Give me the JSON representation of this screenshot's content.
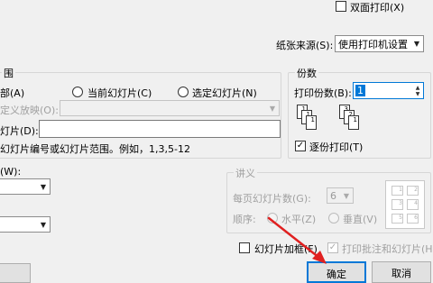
{
  "duplex": {
    "label": "双面打印(X)",
    "checked": false
  },
  "paper_source": {
    "label": "纸张来源(S):",
    "value": "使用打印机设置"
  },
  "print_range": {
    "title": "围",
    "all_label": "部(A)",
    "current_slide_label": "当前幻灯片(C)",
    "selection_label": "选定幻灯片(N)",
    "custom_show_label": "定义放映(O):",
    "slides_label": "灯片(D):",
    "hint": "幻灯片编号或幻灯片范围。例如，1,3,5-12"
  },
  "copies": {
    "title": "份数",
    "count_label": "打印份数(B):",
    "count_value": "1",
    "collate_label": "逐份打印(T)",
    "collate_checked": true,
    "stack1": [
      "1",
      "1",
      "1"
    ],
    "stack2": [
      "3",
      "2",
      "1"
    ]
  },
  "print_what": {
    "label": "(W):",
    "value": ""
  },
  "color": {
    "value": ""
  },
  "handouts": {
    "title": "讲义",
    "per_page_label": "每页幻灯片数(G):",
    "per_page_value": "6",
    "order_label": "顺序:",
    "horizontal_label": "水平(Z)",
    "vertical_label": "垂直(V)",
    "preview_numbers": [
      "1",
      "2",
      "3",
      "4",
      "5",
      "6"
    ]
  },
  "frame_slides": {
    "label": "幻灯片加框(F)",
    "checked": false
  },
  "print_comments": {
    "label": "打印批注和幻灯片(H)",
    "checked": true
  },
  "ok_button": {
    "label": "确定"
  },
  "cancel_button": {
    "label": "取消"
  },
  "colors": {
    "accent": "#0078d7",
    "arrow": "#e02020"
  }
}
